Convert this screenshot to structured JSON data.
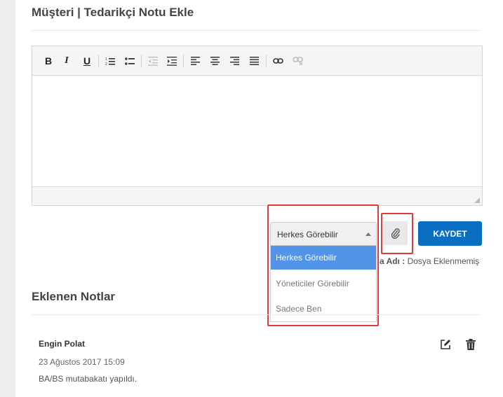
{
  "form": {
    "title": "Müşteri | Tedarikçi Notu Ekle"
  },
  "editor": {
    "toolbar": [
      "bold",
      "italic",
      "underline",
      "ordered-list",
      "unordered-list",
      "outdent",
      "indent",
      "align-left",
      "align-center",
      "align-right",
      "justify",
      "link",
      "unlink"
    ],
    "bold_label": "B",
    "italic_label": "I",
    "underline_label": "U"
  },
  "visibility": {
    "selected": "Herkes Görebilir",
    "options": [
      "Herkes Görebilir",
      "Yöneticiler Görebilir",
      "Sadece Ben"
    ]
  },
  "actions": {
    "save_label": "KAYDET",
    "attach_icon": "paperclip-icon"
  },
  "file": {
    "label": "a Adı :",
    "value": "Dosya Eklenmemiş"
  },
  "notes": {
    "title": "Eklenen Notlar",
    "items": [
      {
        "author": "Engin Polat",
        "date": "23 Ağustos 2017 15:09",
        "text": "BA/BS mutabakatı yapıldı."
      }
    ]
  },
  "colors": {
    "accent": "#0a6fc2",
    "selected_option": "#5294e8",
    "highlight_frame": "#e03b3b"
  }
}
